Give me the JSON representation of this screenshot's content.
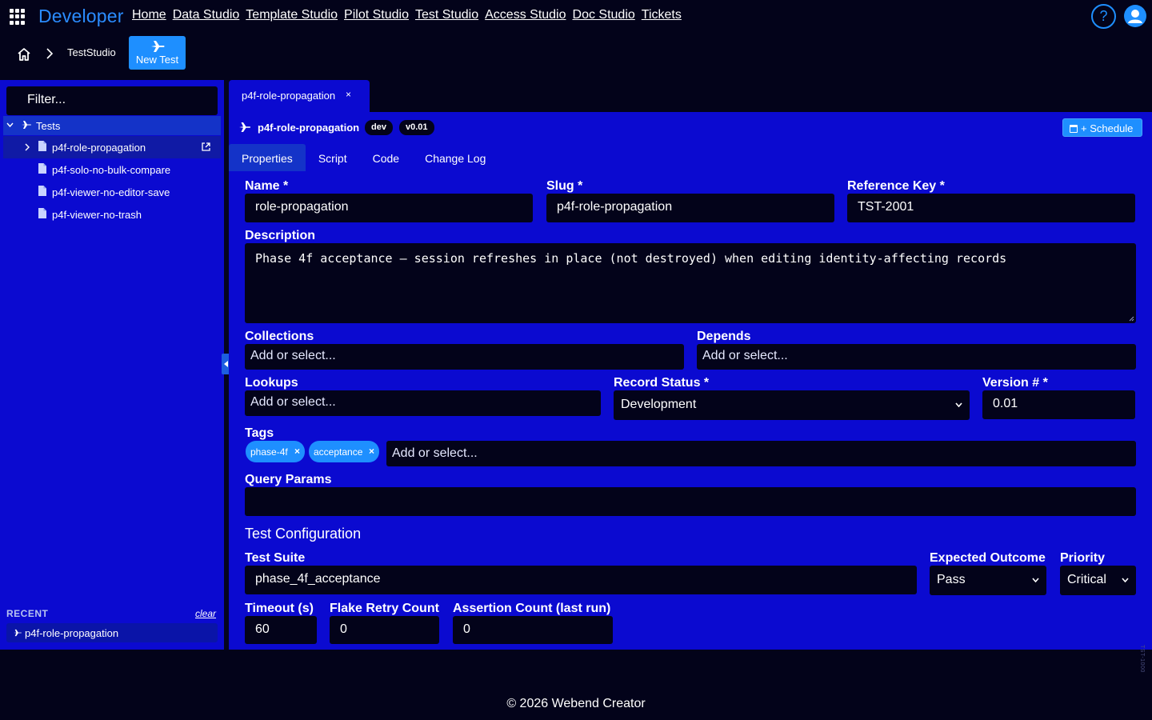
{
  "app": {
    "brand": "Developer",
    "nav": [
      "Home",
      "Data Studio",
      "Template Studio",
      "Pilot Studio",
      "Test Studio",
      "Access Studio",
      "Doc Studio",
      "Tickets"
    ],
    "help_icon": "question-icon",
    "user_icon": "user-avatar-icon"
  },
  "breadcrumb": {
    "current": "TestStudio",
    "new_button": "New Test"
  },
  "sidebar": {
    "filter_placeholder": "Filter...",
    "root_label": "Tests",
    "items": [
      {
        "label": "p4f-role-propagation",
        "selected": true
      },
      {
        "label": "p4f-solo-no-bulk-compare"
      },
      {
        "label": "p4f-viewer-no-editor-save"
      },
      {
        "label": "p4f-viewer-no-trash"
      }
    ],
    "recent_title": "RECENT",
    "recent_clear": "clear",
    "recent_items": [
      "p4f-role-propagation"
    ]
  },
  "editor": {
    "tab_label": "p4f-role-propagation",
    "tab_close": "×",
    "record_title": "p4f-role-propagation",
    "badge_env": "dev",
    "badge_version": "v0.01",
    "schedule_label": "+ Schedule",
    "tabs": [
      "Properties",
      "Script",
      "Code",
      "Change Log"
    ],
    "active_tab": "Properties",
    "fields": {
      "name_label": "Name *",
      "name_value": "role-propagation",
      "slug_label": "Slug *",
      "slug_value": "p4f-role-propagation",
      "refkey_label": "Reference Key *",
      "refkey_value": "TST-2001",
      "description_label": "Description",
      "description_value": "Phase 4f acceptance — session refreshes in place (not destroyed) when editing identity-affecting records",
      "collections_label": "Collections",
      "collections_placeholder": "Add or select...",
      "depends_label": "Depends",
      "depends_placeholder": "Add or select...",
      "lookups_label": "Lookups",
      "lookups_placeholder": "Add or select...",
      "status_label": "Record Status *",
      "status_value": "Development",
      "version_label": "Version # *",
      "version_value": "0.01",
      "tags_label": "Tags",
      "tags": [
        "phase-4f",
        "acceptance"
      ],
      "tags_placeholder": "Add or select...",
      "query_label": "Query Params",
      "query_value": ""
    },
    "config": {
      "section_title": "Test Configuration",
      "suite_label": "Test Suite",
      "suite_value": "phase_4f_acceptance",
      "outcome_label": "Expected Outcome",
      "outcome_value": "Pass",
      "priority_label": "Priority",
      "priority_value": "Critical",
      "timeout_label": "Timeout (s)",
      "timeout_value": "60",
      "flake_label": "Flake Retry Count",
      "flake_value": "0",
      "assert_label": "Assertion Count (last run)",
      "assert_value": "0"
    }
  },
  "footer": {
    "copyright": "© 2026 Webend Creator",
    "side_id": "TST-1000"
  }
}
